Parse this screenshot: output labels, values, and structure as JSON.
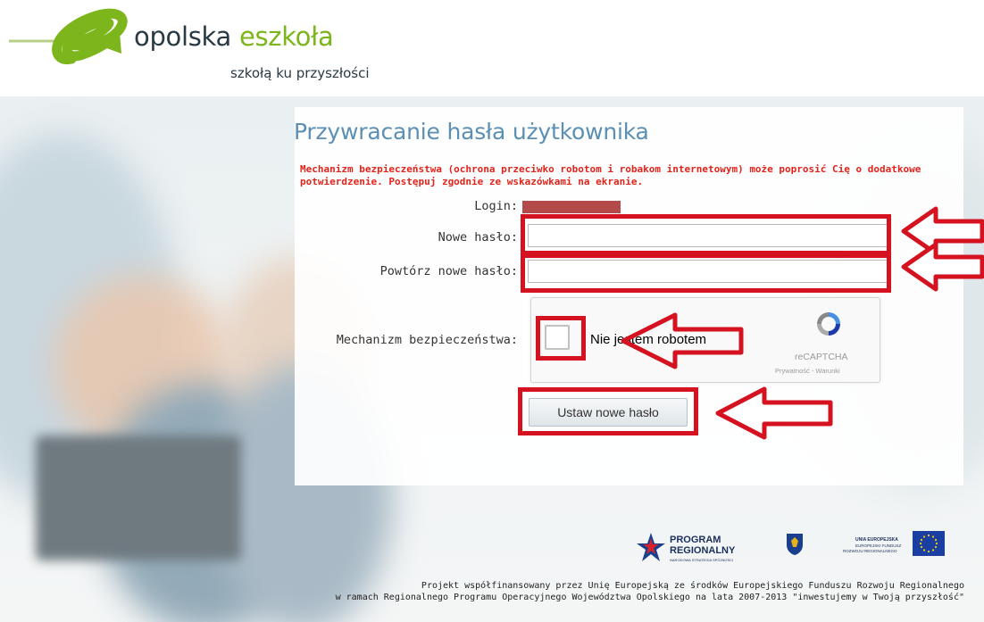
{
  "header": {
    "brand_part1": "opolska ",
    "brand_part2": "eszkoła",
    "tagline": "szkołą ku przyszłości"
  },
  "form": {
    "title": "Przywracanie hasła użytkownika",
    "warning": "Mechanizm bezpieczeństwa (ochrona przeciwko robotom i robakom internetowym) może poprosić Cię o dodatkowe potwierdzenie. Postępuj zgodnie ze wskazówkami na ekranie.",
    "login_label": "Login:",
    "new_password_label": "Nowe hasło:",
    "repeat_password_label": "Powtórz nowe hasło:",
    "security_label": "Mechanizm bezpieczeństwa:",
    "submit_label": "Ustaw nowe hasło"
  },
  "captcha": {
    "checkbox_label": "Nie jestem robotem",
    "brand": "reCAPTCHA",
    "links": "Prywatność - Warunki"
  },
  "sponsors": {
    "program_line1": "PROGRAM",
    "program_line2": "REGIONALNY",
    "program_sub": "NARODOWA STRATEGIA SPÓJNOŚCI",
    "eu_line1": "UNIA EUROPEJSKA",
    "eu_line2": "EUROPEJSKI FUNDUSZ",
    "eu_line3": "ROZWOJU REGIONALNEGO"
  },
  "footer": {
    "line1": "Projekt współfinansowany przez Unię Europejską ze środków Europejskiego Funduszu Rozwoju Regionalnego",
    "line2": "w ramach Regionalnego Programu Operacyjnego Województwa Opolskiego na lata 2007-2013 \"inwestujemy w Twoją przyszłość\""
  },
  "colors": {
    "title": "#5b8fb4",
    "warning": "#e2231a",
    "annotation": "#d41220",
    "brand_green": "#7cb61c"
  }
}
